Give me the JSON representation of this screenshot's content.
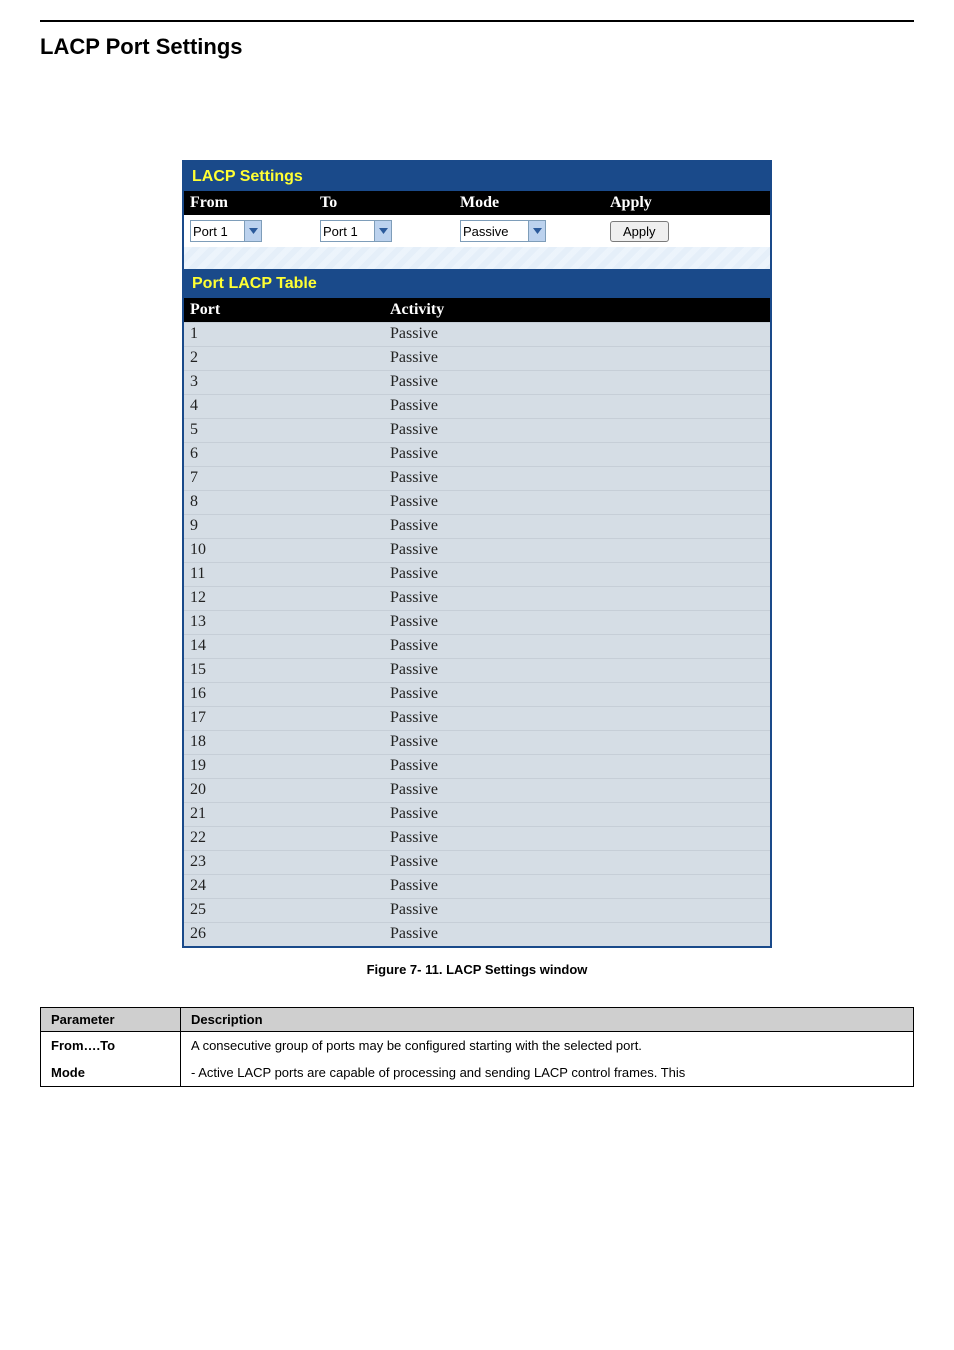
{
  "pageTitle": "LACP Port Settings",
  "panel": {
    "topTitle": "LACP Settings",
    "controls": {
      "headers": {
        "from": "From",
        "to": "To",
        "mode": "Mode",
        "apply": "Apply"
      },
      "fromValue": "Port 1",
      "toValue": "Port 1",
      "modeValue": "Passive",
      "applyLabel": "Apply"
    },
    "tableTitle": "Port LACP Table",
    "tableHeaders": {
      "port": "Port",
      "activity": "Activity"
    },
    "rows": [
      {
        "port": "1",
        "activity": "Passive"
      },
      {
        "port": "2",
        "activity": "Passive"
      },
      {
        "port": "3",
        "activity": "Passive"
      },
      {
        "port": "4",
        "activity": "Passive"
      },
      {
        "port": "5",
        "activity": "Passive"
      },
      {
        "port": "6",
        "activity": "Passive"
      },
      {
        "port": "7",
        "activity": "Passive"
      },
      {
        "port": "8",
        "activity": "Passive"
      },
      {
        "port": "9",
        "activity": "Passive"
      },
      {
        "port": "10",
        "activity": "Passive"
      },
      {
        "port": "11",
        "activity": "Passive"
      },
      {
        "port": "12",
        "activity": "Passive"
      },
      {
        "port": "13",
        "activity": "Passive"
      },
      {
        "port": "14",
        "activity": "Passive"
      },
      {
        "port": "15",
        "activity": "Passive"
      },
      {
        "port": "16",
        "activity": "Passive"
      },
      {
        "port": "17",
        "activity": "Passive"
      },
      {
        "port": "18",
        "activity": "Passive"
      },
      {
        "port": "19",
        "activity": "Passive"
      },
      {
        "port": "20",
        "activity": "Passive"
      },
      {
        "port": "21",
        "activity": "Passive"
      },
      {
        "port": "22",
        "activity": "Passive"
      },
      {
        "port": "23",
        "activity": "Passive"
      },
      {
        "port": "24",
        "activity": "Passive"
      },
      {
        "port": "25",
        "activity": "Passive"
      },
      {
        "port": "26",
        "activity": "Passive"
      }
    ]
  },
  "caption": "Figure 7- 11. LACP Settings window",
  "paramTable": {
    "headers": {
      "param": "Parameter",
      "desc": "Description"
    },
    "rows": [
      {
        "param": "From….To",
        "desc": "A consecutive group of ports may be configured starting with the selected port."
      },
      {
        "param": "Mode",
        "desc": "- Active LACP ports are capable of processing and sending LACP control frames. This"
      }
    ]
  }
}
